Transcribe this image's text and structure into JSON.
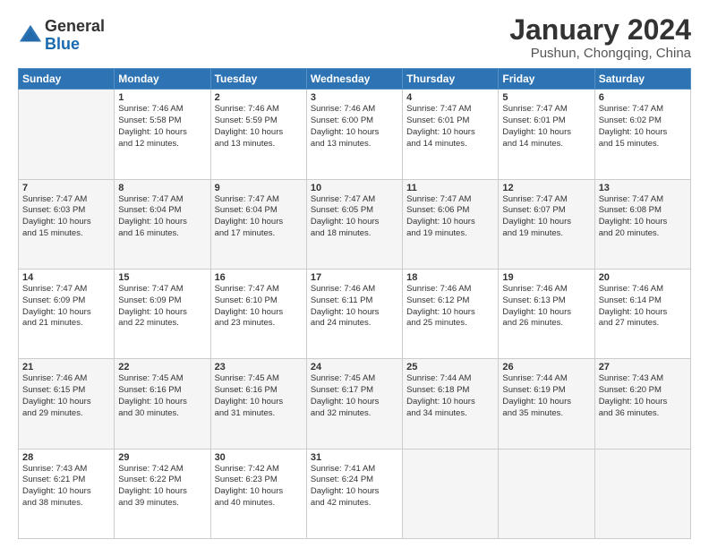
{
  "logo": {
    "general": "General",
    "blue": "Blue"
  },
  "title": "January 2024",
  "location": "Pushun, Chongqing, China",
  "days_header": [
    "Sunday",
    "Monday",
    "Tuesday",
    "Wednesday",
    "Thursday",
    "Friday",
    "Saturday"
  ],
  "weeks": [
    [
      {
        "day": "",
        "info": ""
      },
      {
        "day": "1",
        "info": "Sunrise: 7:46 AM\nSunset: 5:58 PM\nDaylight: 10 hours\nand 12 minutes."
      },
      {
        "day": "2",
        "info": "Sunrise: 7:46 AM\nSunset: 5:59 PM\nDaylight: 10 hours\nand 13 minutes."
      },
      {
        "day": "3",
        "info": "Sunrise: 7:46 AM\nSunset: 6:00 PM\nDaylight: 10 hours\nand 13 minutes."
      },
      {
        "day": "4",
        "info": "Sunrise: 7:47 AM\nSunset: 6:01 PM\nDaylight: 10 hours\nand 14 minutes."
      },
      {
        "day": "5",
        "info": "Sunrise: 7:47 AM\nSunset: 6:01 PM\nDaylight: 10 hours\nand 14 minutes."
      },
      {
        "day": "6",
        "info": "Sunrise: 7:47 AM\nSunset: 6:02 PM\nDaylight: 10 hours\nand 15 minutes."
      }
    ],
    [
      {
        "day": "7",
        "info": "Sunrise: 7:47 AM\nSunset: 6:03 PM\nDaylight: 10 hours\nand 15 minutes."
      },
      {
        "day": "8",
        "info": "Sunrise: 7:47 AM\nSunset: 6:04 PM\nDaylight: 10 hours\nand 16 minutes."
      },
      {
        "day": "9",
        "info": "Sunrise: 7:47 AM\nSunset: 6:04 PM\nDaylight: 10 hours\nand 17 minutes."
      },
      {
        "day": "10",
        "info": "Sunrise: 7:47 AM\nSunset: 6:05 PM\nDaylight: 10 hours\nand 18 minutes."
      },
      {
        "day": "11",
        "info": "Sunrise: 7:47 AM\nSunset: 6:06 PM\nDaylight: 10 hours\nand 19 minutes."
      },
      {
        "day": "12",
        "info": "Sunrise: 7:47 AM\nSunset: 6:07 PM\nDaylight: 10 hours\nand 19 minutes."
      },
      {
        "day": "13",
        "info": "Sunrise: 7:47 AM\nSunset: 6:08 PM\nDaylight: 10 hours\nand 20 minutes."
      }
    ],
    [
      {
        "day": "14",
        "info": "Sunrise: 7:47 AM\nSunset: 6:09 PM\nDaylight: 10 hours\nand 21 minutes."
      },
      {
        "day": "15",
        "info": "Sunrise: 7:47 AM\nSunset: 6:09 PM\nDaylight: 10 hours\nand 22 minutes."
      },
      {
        "day": "16",
        "info": "Sunrise: 7:47 AM\nSunset: 6:10 PM\nDaylight: 10 hours\nand 23 minutes."
      },
      {
        "day": "17",
        "info": "Sunrise: 7:46 AM\nSunset: 6:11 PM\nDaylight: 10 hours\nand 24 minutes."
      },
      {
        "day": "18",
        "info": "Sunrise: 7:46 AM\nSunset: 6:12 PM\nDaylight: 10 hours\nand 25 minutes."
      },
      {
        "day": "19",
        "info": "Sunrise: 7:46 AM\nSunset: 6:13 PM\nDaylight: 10 hours\nand 26 minutes."
      },
      {
        "day": "20",
        "info": "Sunrise: 7:46 AM\nSunset: 6:14 PM\nDaylight: 10 hours\nand 27 minutes."
      }
    ],
    [
      {
        "day": "21",
        "info": "Sunrise: 7:46 AM\nSunset: 6:15 PM\nDaylight: 10 hours\nand 29 minutes."
      },
      {
        "day": "22",
        "info": "Sunrise: 7:45 AM\nSunset: 6:16 PM\nDaylight: 10 hours\nand 30 minutes."
      },
      {
        "day": "23",
        "info": "Sunrise: 7:45 AM\nSunset: 6:16 PM\nDaylight: 10 hours\nand 31 minutes."
      },
      {
        "day": "24",
        "info": "Sunrise: 7:45 AM\nSunset: 6:17 PM\nDaylight: 10 hours\nand 32 minutes."
      },
      {
        "day": "25",
        "info": "Sunrise: 7:44 AM\nSunset: 6:18 PM\nDaylight: 10 hours\nand 34 minutes."
      },
      {
        "day": "26",
        "info": "Sunrise: 7:44 AM\nSunset: 6:19 PM\nDaylight: 10 hours\nand 35 minutes."
      },
      {
        "day": "27",
        "info": "Sunrise: 7:43 AM\nSunset: 6:20 PM\nDaylight: 10 hours\nand 36 minutes."
      }
    ],
    [
      {
        "day": "28",
        "info": "Sunrise: 7:43 AM\nSunset: 6:21 PM\nDaylight: 10 hours\nand 38 minutes."
      },
      {
        "day": "29",
        "info": "Sunrise: 7:42 AM\nSunset: 6:22 PM\nDaylight: 10 hours\nand 39 minutes."
      },
      {
        "day": "30",
        "info": "Sunrise: 7:42 AM\nSunset: 6:23 PM\nDaylight: 10 hours\nand 40 minutes."
      },
      {
        "day": "31",
        "info": "Sunrise: 7:41 AM\nSunset: 6:24 PM\nDaylight: 10 hours\nand 42 minutes."
      },
      {
        "day": "",
        "info": ""
      },
      {
        "day": "",
        "info": ""
      },
      {
        "day": "",
        "info": ""
      }
    ]
  ]
}
